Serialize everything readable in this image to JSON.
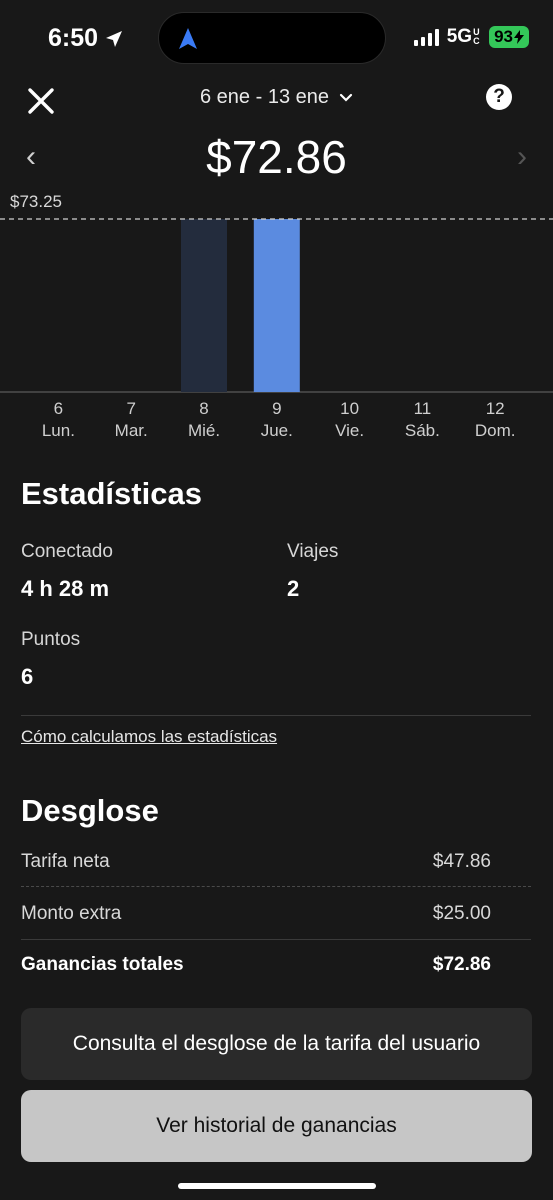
{
  "status_bar": {
    "time": "6:50",
    "network": "5G",
    "network_suffix": "UC",
    "battery": "93",
    "colors": {
      "battery": "#34c759"
    },
    "icons": [
      "location-arrow-icon",
      "navigation-arrow-icon",
      "signal-bars-icon",
      "charging-bolt-icon"
    ]
  },
  "header": {
    "date_range": "6 ene - 13 ene",
    "help_label": "?",
    "prev_label": "‹",
    "next_label": "›"
  },
  "earnings": {
    "total": "$72.86"
  },
  "chart_data": {
    "type": "bar",
    "categories": [
      "6 Lun.",
      "7 Mar.",
      "8 Mié.",
      "9 Jue.",
      "10 Vie.",
      "11 Sáb.",
      "12 Dom."
    ],
    "days": [
      {
        "num": "6",
        "name": "Lun."
      },
      {
        "num": "7",
        "name": "Mar."
      },
      {
        "num": "8",
        "name": "Mié."
      },
      {
        "num": "9",
        "name": "Jue."
      },
      {
        "num": "10",
        "name": "Vie."
      },
      {
        "num": "11",
        "name": "Sáb."
      },
      {
        "num": "12",
        "name": "Dom."
      }
    ],
    "values": [
      0,
      0,
      73.25,
      73.25,
      0,
      0,
      0
    ],
    "selected_index": 3,
    "reference_line": {
      "value": 73.25,
      "label": "$73.25"
    },
    "ylim": [
      0,
      73.25
    ],
    "colors": {
      "selected": "#5b8be0",
      "default": "#232c3d",
      "reference": "#d0d0d0"
    }
  },
  "stats": {
    "title": "Estadísticas",
    "connected_label": "Conectado",
    "connected_value": "4 h 28 m",
    "trips_label": "Viajes",
    "trips_value": "2",
    "points_label": "Puntos",
    "points_value": "6",
    "link": "Cómo calculamos las estadísticas"
  },
  "breakdown": {
    "title": "Desglose",
    "rows": [
      {
        "label": "Tarifa neta",
        "value": "$47.86"
      },
      {
        "label": "Monto extra",
        "value": "$25.00"
      },
      {
        "label": "Ganancias totales",
        "value": "$72.86"
      }
    ]
  },
  "buttons": {
    "fare_breakdown": "Consulta el desglose de la tarifa del usuario",
    "history": "Ver historial de ganancias"
  }
}
